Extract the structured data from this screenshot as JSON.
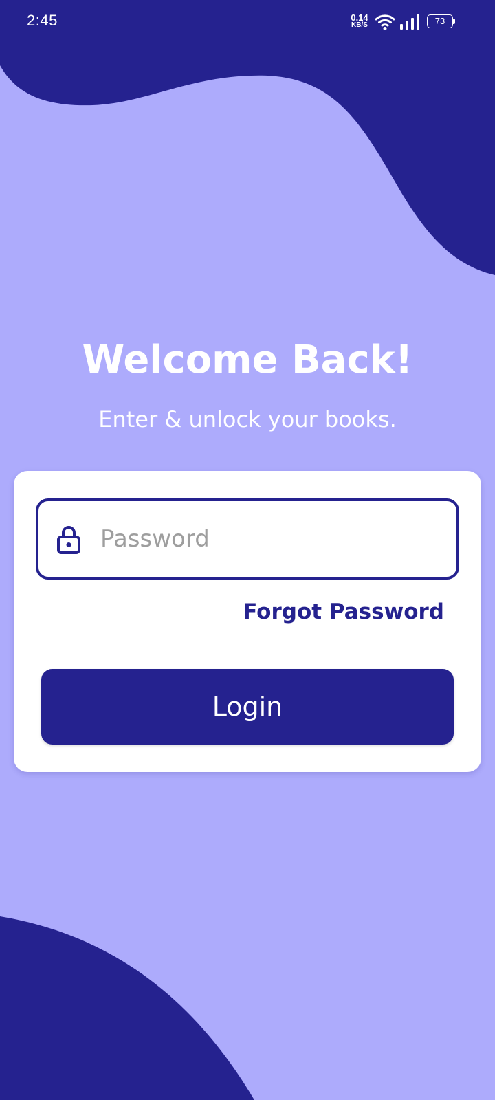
{
  "status_bar": {
    "time": "2:45",
    "net_speed_value": "0.14",
    "net_speed_unit": "KB/S",
    "battery": "73"
  },
  "icons": {
    "wifi": "wifi-icon",
    "signal": "signal-icon",
    "battery": "battery-icon",
    "lock": "lock-icon"
  },
  "login": {
    "title": "Welcome Back!",
    "subtitle": "Enter & unlock your books.",
    "password_placeholder": "Password",
    "password_value": "",
    "forgot_label": "Forgot Password",
    "login_label": "Login"
  },
  "colors": {
    "background": "#adabfc",
    "primary": "#25228f",
    "card": "#ffffff",
    "placeholder": "#9e9e9e"
  }
}
